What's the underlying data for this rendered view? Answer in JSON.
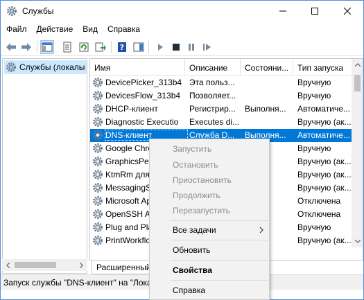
{
  "window": {
    "title": "Службы",
    "icon": "gear-icon"
  },
  "menu": [
    "Файл",
    "Действие",
    "Вид",
    "Справка"
  ],
  "toolbar": {
    "buttons": [
      "back-arrow-icon",
      "forward-arrow-icon",
      "console-tree-icon",
      "properties-icon",
      "refresh-icon",
      "export-icon",
      "help-icon",
      "action-pane-icon",
      "start-icon",
      "stop-icon",
      "pause-icon",
      "restart-icon"
    ]
  },
  "tree": {
    "item": "Службы (локалы"
  },
  "columns": {
    "name": "Имя",
    "description": "Описание",
    "state": "Состояни...",
    "startup": "Тип запуска"
  },
  "services": [
    {
      "name": "DevicePicker_313b4",
      "description": "Эта польз...",
      "state": "",
      "startup": "Вручную"
    },
    {
      "name": "DevicesFlow_313b4",
      "description": "Позволяет...",
      "state": "",
      "startup": "Вручную"
    },
    {
      "name": "DHCP-клиент",
      "description": "Регистрир...",
      "state": "Выполня...",
      "startup": "Автоматиче..."
    },
    {
      "name": "Diagnostic Executio",
      "description": "Executes di...",
      "state": "",
      "startup": "Вручную (ак..."
    },
    {
      "name": "DNS-клиент",
      "description": "Служба D...",
      "state": "Выполня...",
      "startup": "Автоматиче..."
    },
    {
      "name": "Google Chro",
      "description": "",
      "state": "",
      "startup": "Вручную"
    },
    {
      "name": "GraphicsPerf",
      "description": "",
      "state": "",
      "startup": "Вручную (ак..."
    },
    {
      "name": "KtmRm для",
      "description": "",
      "state": "",
      "startup": "Вручную (ак..."
    },
    {
      "name": "MessagingS",
      "description": "",
      "state": "",
      "startup": "Вручную (ак..."
    },
    {
      "name": "Microsoft Ap",
      "description": "",
      "state": "",
      "startup": "Отключена"
    },
    {
      "name": "OpenSSH Au",
      "description": "",
      "state": "",
      "startup": "Отключена"
    },
    {
      "name": "Plug and Pla",
      "description": "",
      "state": "",
      "startup": "Вручную"
    },
    {
      "name": "PrintWorkflo",
      "description": "",
      "state": "",
      "startup": "Вручную (ак..."
    }
  ],
  "selected_index": 4,
  "tabs": {
    "extended": "Расширенный"
  },
  "status": "Запуск службы \"DNS-клиент\" на \"Лока",
  "context_menu": {
    "start": "Запустить",
    "stop": "Остановить",
    "pause": "Приостановить",
    "resume": "Продолжить",
    "restart": "Перезапустить",
    "all_tasks": "Все задачи",
    "refresh": "Обновить",
    "properties": "Свойства",
    "help": "Справка"
  },
  "colors": {
    "selection": "#0078d7",
    "tree_selection": "#cce8ff",
    "menu_bg": "#f2f2f2",
    "disabled_text": "#8c8c8c"
  }
}
